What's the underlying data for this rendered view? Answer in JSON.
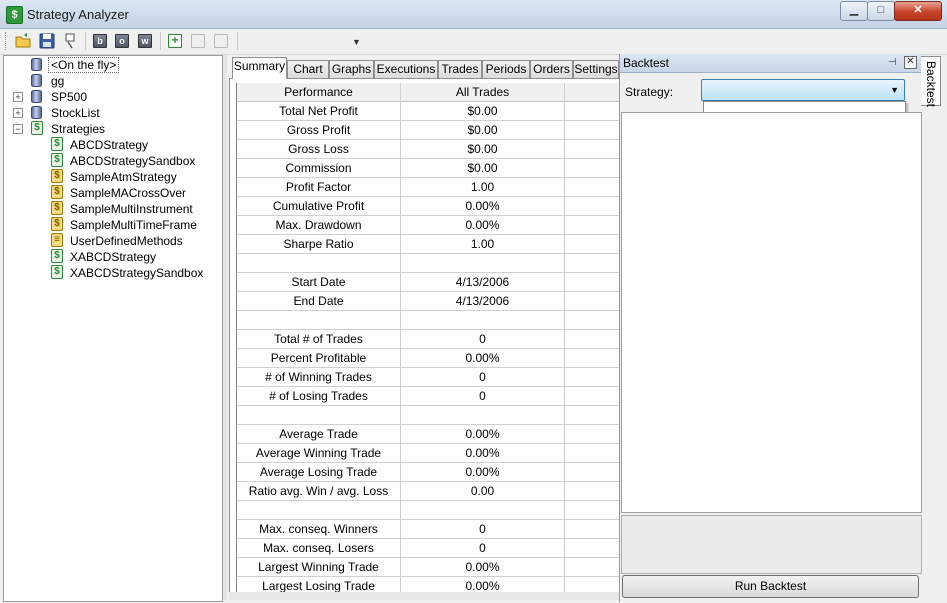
{
  "window": {
    "title": "Strategy Analyzer",
    "minimize_glyph": "▁",
    "maximize_glyph": "□",
    "close_glyph": "✕"
  },
  "toolbar": {
    "buttons": [
      {
        "name": "open-folder-icon",
        "glyph": "📂"
      },
      {
        "name": "save-icon",
        "glyph": "💾"
      },
      {
        "name": "print-icon",
        "glyph": "🖶"
      },
      {
        "name": "b-button",
        "glyph": "b"
      },
      {
        "name": "o-button",
        "glyph": "o"
      },
      {
        "name": "w-button",
        "glyph": "w"
      },
      {
        "name": "add-icon",
        "glyph": "+"
      }
    ],
    "dropdown_arrow": "▼"
  },
  "tree": {
    "items": [
      {
        "label": "<On the fly>",
        "icon": "database-icon",
        "level": 0,
        "selected": true
      },
      {
        "label": "gg",
        "icon": "database-icon",
        "level": 0
      },
      {
        "label": "SP500",
        "icon": "database-icon",
        "level": 0,
        "expander": "+"
      },
      {
        "label": "StockList",
        "icon": "database-icon",
        "level": 0,
        "expander": "+"
      },
      {
        "label": "Strategies",
        "icon": "strategy-icon",
        "level": 0,
        "expander": "−"
      },
      {
        "label": "ABCDStrategy",
        "icon": "strategy-icon",
        "level": 1
      },
      {
        "label": "ABCDStrategySandbox",
        "icon": "strategy-icon",
        "level": 1
      },
      {
        "label": "SampleAtmStrategy",
        "icon": "locked-strategy-icon",
        "level": 1
      },
      {
        "label": "SampleMACrossOver",
        "icon": "locked-strategy-icon",
        "level": 1
      },
      {
        "label": "SampleMultiInstrument",
        "icon": "locked-strategy-icon",
        "level": 1
      },
      {
        "label": "SampleMultiTimeFrame",
        "icon": "locked-strategy-icon",
        "level": 1
      },
      {
        "label": "UserDefinedMethods",
        "icon": "methods-icon",
        "level": 1
      },
      {
        "label": "XABCDStrategy",
        "icon": "strategy-icon",
        "level": 1
      },
      {
        "label": "XABCDStrategySandbox",
        "icon": "strategy-icon",
        "level": 1
      }
    ]
  },
  "tabs": [
    "Summary",
    "Chart",
    "Graphs",
    "Executions",
    "Trades",
    "Periods",
    "Orders",
    "Settings"
  ],
  "active_tab": "Summary",
  "summary": {
    "headers": [
      "Performance",
      "All Trades",
      ""
    ],
    "rows": [
      [
        "Total Net Profit",
        "$0.00"
      ],
      [
        "Gross Profit",
        "$0.00"
      ],
      [
        "Gross Loss",
        "$0.00"
      ],
      [
        "Commission",
        "$0.00"
      ],
      [
        "Profit Factor",
        "1.00"
      ],
      [
        "Cumulative Profit",
        "0.00%"
      ],
      [
        "Max. Drawdown",
        "0.00%"
      ],
      [
        "Sharpe Ratio",
        "1.00"
      ],
      [
        "",
        ""
      ],
      [
        "Start Date",
        "4/13/2006"
      ],
      [
        "End Date",
        "4/13/2006"
      ],
      [
        "",
        ""
      ],
      [
        "Total # of Trades",
        "0"
      ],
      [
        "Percent Profitable",
        "0.00%"
      ],
      [
        "# of Winning Trades",
        "0"
      ],
      [
        "# of Losing Trades",
        "0"
      ],
      [
        "",
        ""
      ],
      [
        "Average Trade",
        "0.00%"
      ],
      [
        "Average Winning Trade",
        "0.00%"
      ],
      [
        "Average Losing Trade",
        "0.00%"
      ],
      [
        "Ratio avg. Win / avg. Loss",
        "0.00"
      ],
      [
        "",
        ""
      ],
      [
        "Max. conseq. Winners",
        "0"
      ],
      [
        "Max. conseq. Losers",
        "0"
      ],
      [
        "Largest Winning Trade",
        "0.00%"
      ],
      [
        "Largest Losing Trade",
        "0.00%"
      ]
    ]
  },
  "backtest": {
    "title": "Backtest",
    "pin_glyph": "⊣",
    "close_glyph": "✕",
    "strategy_label": "Strategy:",
    "strategy_value": "",
    "dropdown_arrow": "▼",
    "run_button": "Run Backtest",
    "side_tab_label": "Backtest"
  }
}
